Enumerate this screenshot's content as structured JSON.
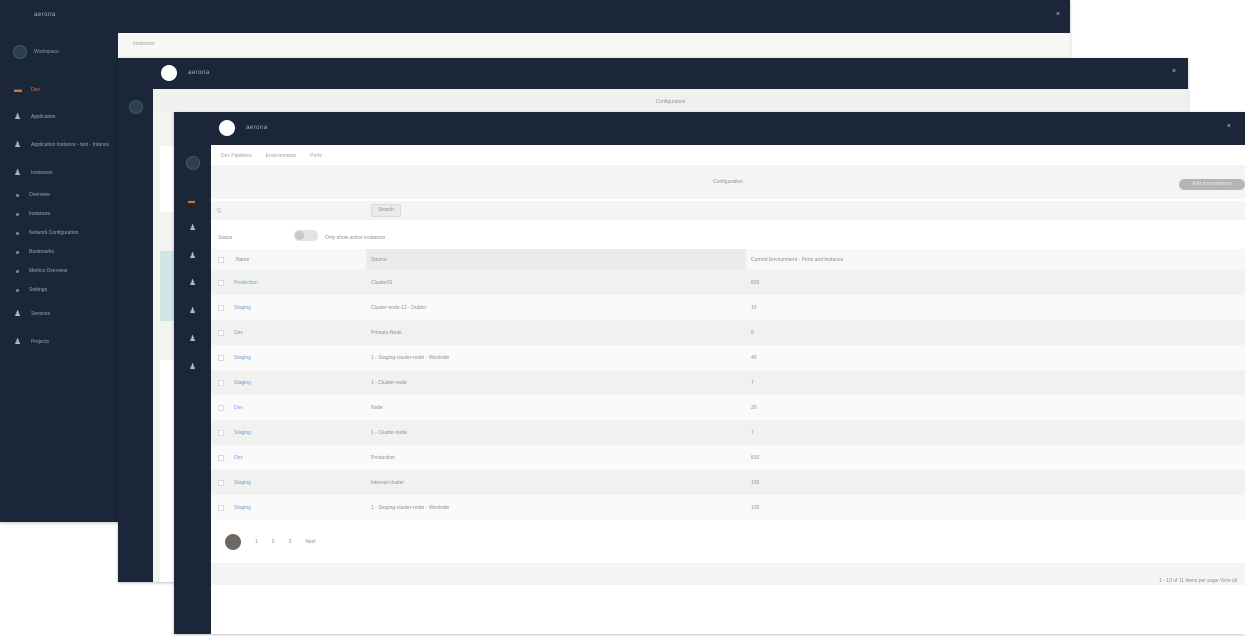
{
  "window_back": {
    "brand": "aerona",
    "breadcrumb": "Instances",
    "nav": [
      {
        "label": "Dev",
        "icon": "home-icon",
        "accent": true
      },
      {
        "label": "Application",
        "icon": "user-icon"
      },
      {
        "label": "Application Instance - test - Intance",
        "icon": "user-icon"
      },
      {
        "label": "Instances",
        "icon": "user-icon"
      },
      {
        "label": "Overview",
        "icon": "dot"
      },
      {
        "label": "Instances",
        "icon": "dot"
      },
      {
        "label": "Network Configuration",
        "icon": "dot"
      },
      {
        "label": "Bookmarks",
        "icon": "dot"
      },
      {
        "label": "Metrics Overview",
        "icon": "dot"
      },
      {
        "label": "Settings",
        "icon": "dot"
      },
      {
        "label": "Services",
        "icon": "user-icon"
      },
      {
        "label": "Projects",
        "icon": "user-icon"
      }
    ],
    "user": "Workspace"
  },
  "window_middle": {
    "brand": "aerona",
    "title": "Configuration"
  },
  "window_front": {
    "brand": "aerona",
    "breadcrumbs": [
      "Dev Pipelines",
      "Environments",
      "Ports"
    ],
    "title": "Configuration",
    "action_button": "Add new instance",
    "search_placeholder": "Q",
    "search_button": "Search",
    "filter_label": "Status",
    "toggle_label": "Only show active instances",
    "columns": [
      "Name",
      "Source",
      "Current Environment - Ports and Instance"
    ],
    "rows": [
      {
        "name": "Production",
        "source": "Cluster01",
        "value": "820"
      },
      {
        "name": "Staging",
        "source": "Cluster-node-12 - Dubbo",
        "value": "10"
      },
      {
        "name": "Dev",
        "source": "Primary-Node",
        "value": "8"
      },
      {
        "name": "Staging",
        "source": "1 - Staging-cluster-node - Westside",
        "value": "40"
      },
      {
        "name": "Staging",
        "source": "1 - Cluster-node",
        "value": "7"
      },
      {
        "name": "Dev",
        "source": "Node",
        "value": "20"
      },
      {
        "name": "Staging",
        "source": "1 - Cluster-node",
        "value": "7"
      },
      {
        "name": "Dev",
        "source": "Production",
        "value": "810"
      },
      {
        "name": "Staging",
        "source": "Internal-cluster",
        "value": "100"
      },
      {
        "name": "Staging",
        "source": "1 - Staging-cluster-node - Westside",
        "value": "120"
      }
    ],
    "pagination": [
      "1",
      "2",
      "3",
      "Next"
    ],
    "footer": "1 - 10 of 11 items per page",
    "footer_link": "View all"
  }
}
